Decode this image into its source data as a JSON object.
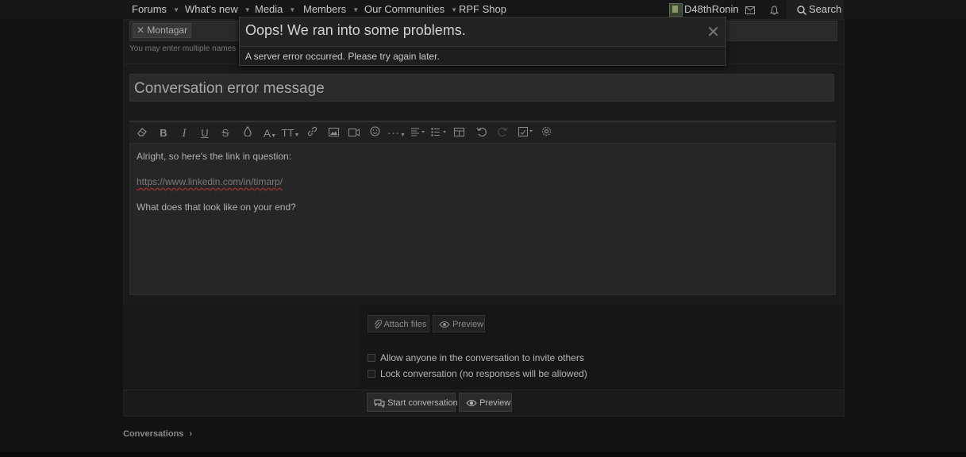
{
  "nav": {
    "items": [
      {
        "label": "Forums",
        "has_caret": true
      },
      {
        "label": "What's new",
        "has_caret": true
      },
      {
        "label": "Media",
        "has_caret": true
      },
      {
        "label": "Members",
        "has_caret": true
      },
      {
        "label": "Our Communities",
        "has_caret": true
      },
      {
        "label": "RPF Shop",
        "has_caret": false
      }
    ],
    "username": "D48thRonin",
    "search_label": "Search"
  },
  "form": {
    "recipient_chip": "Montagar",
    "recipient_hint": "You may enter multiple names",
    "title_value": "Conversation error message",
    "editor_lines": [
      "Alright, so here's the link in question:",
      "https://www.linkedin.com/in/timarp/",
      "What does that look like on your end?"
    ],
    "attach_label": "Attach files",
    "preview_label": "Preview",
    "options": [
      "Allow anyone in the conversation to invite others",
      "Lock conversation (no responses will be allowed)"
    ],
    "start_label": "Start conversation",
    "preview_label_2": "Preview"
  },
  "breadcrumb": {
    "label": "Conversations"
  },
  "modal": {
    "title": "Oops! We ran into some problems.",
    "message": "A server error occurred. Please try again later."
  },
  "colors": {
    "background": "#121212",
    "panel": "#1a1a1a",
    "modal": "#1e1e1e",
    "text": "#c8c8c8"
  }
}
